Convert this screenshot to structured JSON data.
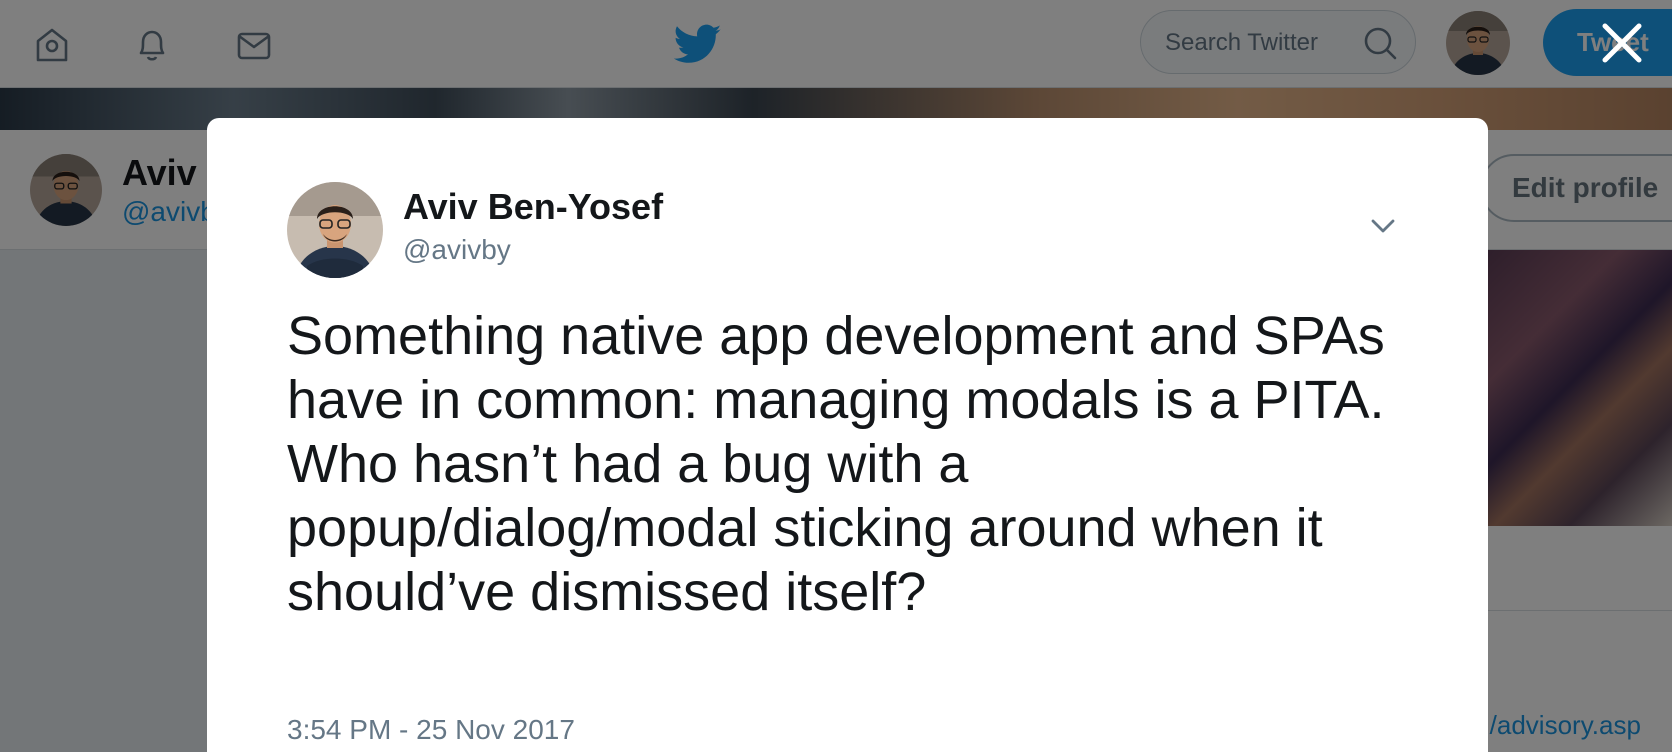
{
  "nav": {
    "search_placeholder": "Search Twitter",
    "tweet_label": "Tweet",
    "icons": [
      "home-icon",
      "notifications-icon",
      "messages-icon",
      "twitter-logo-icon",
      "search-icon"
    ]
  },
  "profile_bar": {
    "name": "Aviv Ben-Yosef",
    "handle": "@avivby",
    "edit_label": "Edit profile",
    "side_link": "m/advisory.asp"
  },
  "modal": {
    "author_name": "Aviv Ben-Yosef",
    "author_handle": "@avivby",
    "tweet_text": "Something native app development and SPAs have in common: managing modals is a PITA.\nWho hasn’t had a bug with a popup/dialog/modal sticking around when it should’ve dismissed itself?",
    "timestamp": "3:54 PM - 25 Nov 2017"
  },
  "colors": {
    "twitter_blue": "#1da1f2",
    "link_blue": "#1b95e0",
    "text_primary": "#14171a",
    "text_secondary": "#657786"
  }
}
